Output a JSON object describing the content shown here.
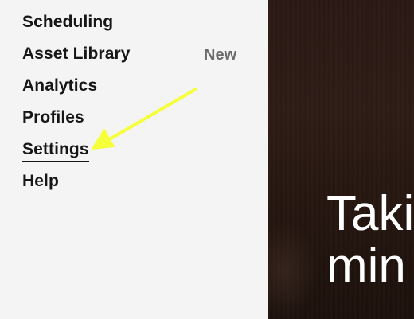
{
  "menu": {
    "items": [
      {
        "label": "Scheduling"
      },
      {
        "label": "Asset Library",
        "badge": "New"
      },
      {
        "label": "Analytics"
      },
      {
        "label": "Profiles"
      },
      {
        "label": "Settings"
      },
      {
        "label": "Help"
      }
    ],
    "active_item": "Settings"
  },
  "hero": {
    "line1": "Taki",
    "line2": "min"
  },
  "annotation": {
    "arrow_color": "#f5ff3a",
    "points_to": "Settings"
  }
}
